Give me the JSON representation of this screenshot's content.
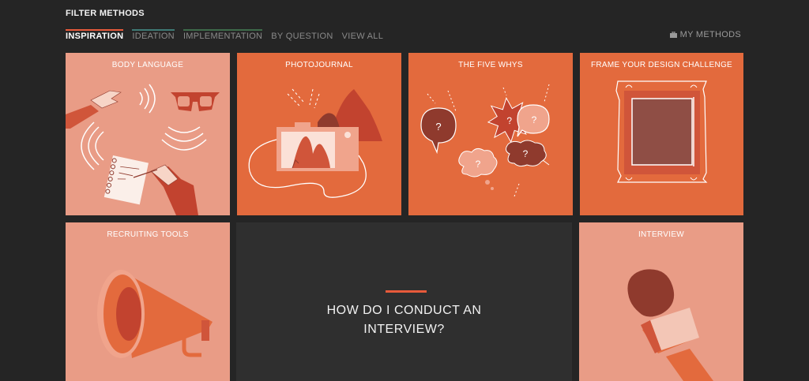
{
  "header": {
    "title": "FILTER METHODS"
  },
  "tabs": [
    {
      "label": "INSPIRATION",
      "color": "#e85a3b",
      "active": true
    },
    {
      "label": "IDEATION",
      "color": "#3f7a75",
      "active": false
    },
    {
      "label": "IMPLEMENTATION",
      "color": "#3e6b4a",
      "active": false
    },
    {
      "label": "BY QUESTION",
      "active": false
    },
    {
      "label": "VIEW ALL",
      "active": false
    }
  ],
  "my_methods": {
    "label": "MY METHODS",
    "icon": "briefcase-icon"
  },
  "cards": [
    {
      "title": "BODY LANGUAGE",
      "bg": "#e99c86"
    },
    {
      "title": "PHOTOJOURNAL",
      "bg": "#e36a3d"
    },
    {
      "title": "THE FIVE WHYS",
      "bg": "#e36a3d"
    },
    {
      "title": "FRAME YOUR DESIGN CHALLENGE",
      "bg": "#e36a3d"
    },
    {
      "title": "RECRUITING TOOLS",
      "bg": "#e99c86"
    },
    {
      "title": "INTERVIEW",
      "bg": "#e99c86"
    }
  ],
  "feature": {
    "question": "HOW DO I CONDUCT AN INTERVIEW?",
    "accent": "#e85a3b"
  },
  "colors": {
    "background": "#252525",
    "accent": "#e85a3b",
    "dark_red": "#8f3a2d",
    "light_pink": "#f3c6b6"
  }
}
